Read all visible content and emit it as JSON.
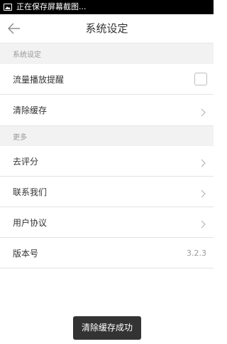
{
  "status_bar": {
    "notification_text": "正在保存屏幕截图...",
    "icon": "screenshot-image-icon"
  },
  "navbar": {
    "back_icon": "back-arrow-icon",
    "title": "系统设定"
  },
  "sections": [
    {
      "header": "系统设定",
      "rows": [
        {
          "label": "流量播放提醒",
          "control": "checkbox",
          "checked": false
        },
        {
          "label": "清除缓存",
          "control": "chevron-right-icon"
        }
      ]
    },
    {
      "header": "更多",
      "rows": [
        {
          "label": "去评分",
          "control": "chevron-right-icon"
        },
        {
          "label": "联系我们",
          "control": "chevron-right-icon"
        },
        {
          "label": "用户协议",
          "control": "chevron-right-icon"
        },
        {
          "label": "版本号",
          "control": "value",
          "value": "3.2.3"
        }
      ]
    }
  ],
  "toast": {
    "message": "清除缓存成功"
  },
  "colors": {
    "section_bg": "#f2f2f2",
    "divider": "#e3e3e3",
    "toast_bg": "#333333",
    "secondary_text": "#999999"
  }
}
